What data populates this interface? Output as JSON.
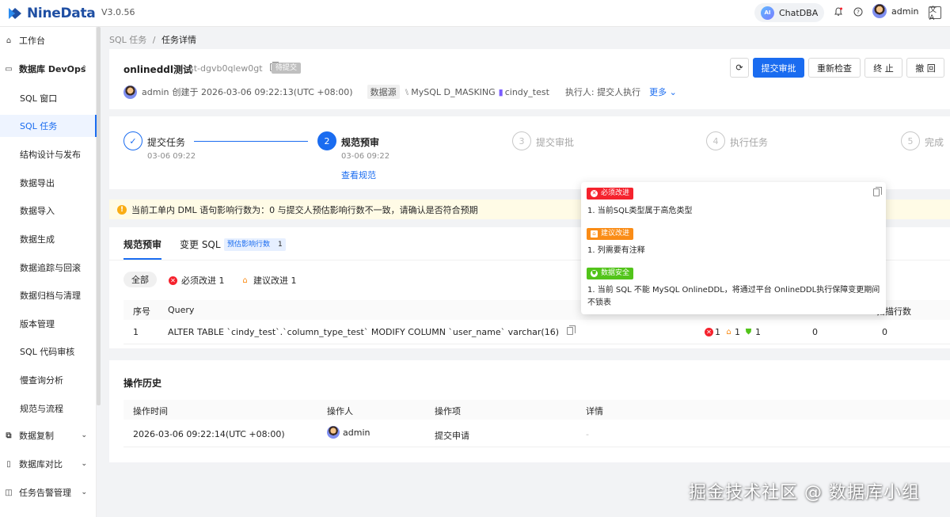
{
  "app": {
    "brand": "NineData",
    "version": "V3.0.56",
    "chatdba": "ChatDBA",
    "chatdba_icon_text": "AI",
    "user": "admin",
    "lang_icon_text": "文A"
  },
  "sidebar": {
    "workbench": "工作台",
    "devops_group": "数据库 DevOps",
    "items": [
      "SQL 窗口",
      "SQL 任务",
      "结构设计与发布",
      "数据导出",
      "数据导入",
      "数据生成",
      "数据追踪与回滚",
      "数据归档与清理",
      "版本管理",
      "SQL 代码审核",
      "慢查询分析",
      "规范与流程"
    ],
    "active_index": 1,
    "replication": "数据复制",
    "compare": "数据库对比",
    "alert": "任务告警管理"
  },
  "breadcrumb": {
    "parent": "SQL 任务",
    "sep": "/",
    "current": "任务详情"
  },
  "task": {
    "title": "onlineddl测试",
    "id": "st-dgvb0qlew0gt",
    "status": "待提交",
    "creator": "admin",
    "created_text": "创建于 2026-03-06 09:22:13(UTC +08:00)",
    "datasource_label": "数据源",
    "datasource": "MySQL D_MASKING",
    "database": "cindy_test",
    "executor": "执行人:  提交人执行",
    "more": "更多"
  },
  "actions": {
    "refresh": "⟳",
    "submit": "提交审批",
    "recheck": "重新检查",
    "terminate": "终 止",
    "revoke": "撤 回"
  },
  "steps": [
    {
      "label": "提交任务",
      "time": "03-06 09:22",
      "state": "done",
      "num": "✓"
    },
    {
      "label": "规范预审",
      "time": "03-06 09:22",
      "state": "active",
      "num": "2",
      "link": "查看规范"
    },
    {
      "label": "提交审批",
      "time": "",
      "state": "todo",
      "num": "3"
    },
    {
      "label": "执行任务",
      "time": "",
      "state": "todo",
      "num": "4"
    },
    {
      "label": "完成",
      "time": "",
      "state": "todo",
      "num": "5"
    }
  ],
  "warning": "当前工单内 DML 语句影响行数为：0 与提交人预估影响行数不一致，请确认是否符合预期",
  "tabs": {
    "precheck": "规范预审",
    "change_sql": "变更 SQL",
    "badge": "预估影响行数",
    "badge_value": "1"
  },
  "filters": {
    "all": "全部",
    "must": "必须改进 1",
    "suggest": "建议改进 1"
  },
  "table": {
    "headers": {
      "no": "序号",
      "query": "Query",
      "scan": "扫描行数"
    },
    "rows": [
      {
        "no": "1",
        "query": "ALTER TABLE `cindy_test`.`column_type_test` MODIFY COLUMN `user_name` varchar(16)",
        "err": "1",
        "sug": "1",
        "safe": "1",
        "affected": "0",
        "scan": "0"
      }
    ]
  },
  "popover": {
    "must_tag": "必须改进",
    "must_text": "1. 当前SQL类型属于高危类型",
    "suggest_tag": "建议改进",
    "suggest_text": "1. 列需要有注释",
    "safe_tag": "数据安全",
    "safe_text": "1. 当前 SQL 不能 MySQL OnlineDDL，将通过平台 OnlineDDL执行保障变更期间不锁表"
  },
  "history": {
    "title": "操作历史",
    "headers": {
      "time": "操作时间",
      "operator": "操作人",
      "item": "操作项",
      "detail": "详情"
    },
    "rows": [
      {
        "time": "2026-03-06 09:22:14(UTC +08:00)",
        "operator": "admin",
        "item": "提交申请",
        "detail": "-"
      }
    ]
  },
  "watermark": "掘金技术社区 @ 数据库小组",
  "colors": {
    "primary": "#1a6cf0",
    "danger": "#f5222d",
    "warning": "#fa8c16",
    "success": "#52c41a",
    "warn_bg": "#fffbe6"
  }
}
